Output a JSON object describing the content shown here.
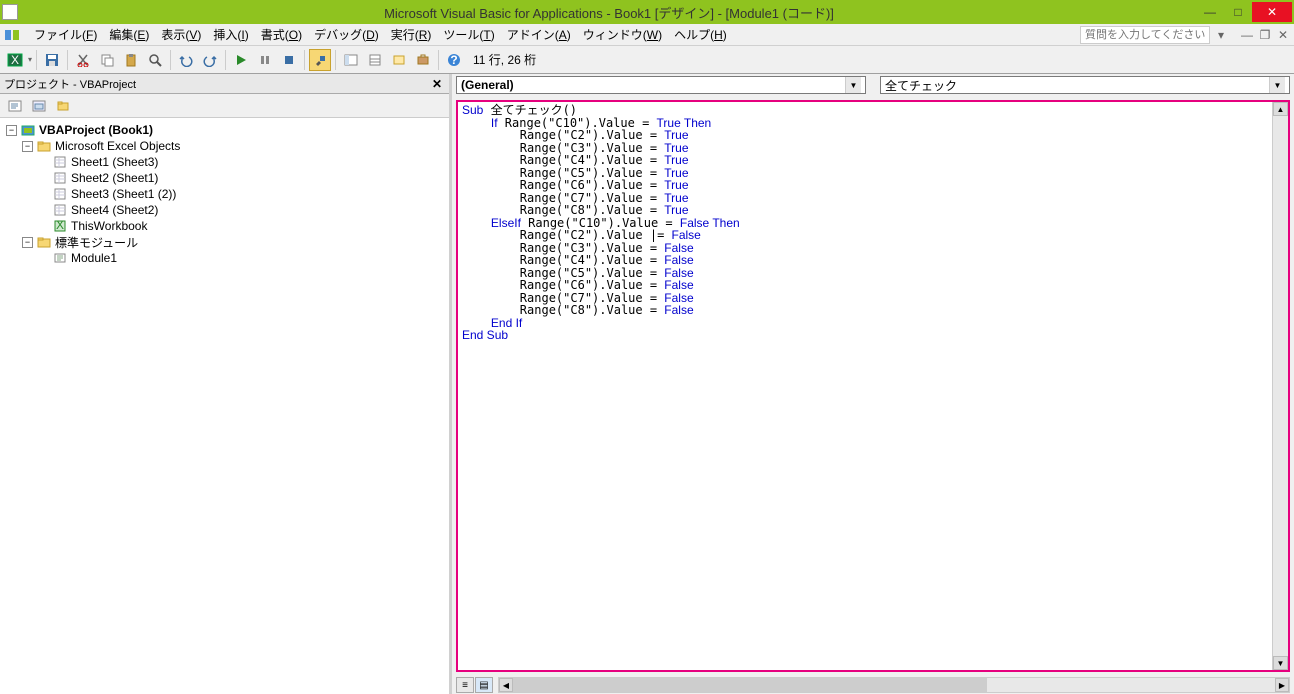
{
  "titlebar": {
    "title": "Microsoft Visual Basic for Applications - Book1 [デザイン] - [Module1 (コード)]"
  },
  "menubar": {
    "items": [
      {
        "label": "ファイル(F)",
        "key": "F"
      },
      {
        "label": "編集(E)",
        "key": "E"
      },
      {
        "label": "表示(V)",
        "key": "V"
      },
      {
        "label": "挿入(I)",
        "key": "I"
      },
      {
        "label": "書式(O)",
        "key": "O"
      },
      {
        "label": "デバッグ(D)",
        "key": "D"
      },
      {
        "label": "実行(R)",
        "key": "R"
      },
      {
        "label": "ツール(T)",
        "key": "T"
      },
      {
        "label": "アドイン(A)",
        "key": "A"
      },
      {
        "label": "ウィンドウ(W)",
        "key": "W"
      },
      {
        "label": "ヘルプ(H)",
        "key": "H"
      }
    ],
    "help_placeholder": "質問を入力してください"
  },
  "toolbar": {
    "status": "11 行, 26 桁"
  },
  "project_panel": {
    "header": "プロジェクト - VBAProject",
    "root": {
      "label": "VBAProject (Book1)"
    },
    "excel_objects": {
      "label": "Microsoft Excel Objects"
    },
    "sheets": [
      {
        "label": "Sheet1 (Sheet3)"
      },
      {
        "label": "Sheet2 (Sheet1)"
      },
      {
        "label": "Sheet3 (Sheet1 (2))"
      },
      {
        "label": "Sheet4 (Sheet2)"
      }
    ],
    "workbook": {
      "label": "ThisWorkbook"
    },
    "modules_folder": {
      "label": "標準モジュール"
    },
    "modules": [
      {
        "label": "Module1"
      }
    ]
  },
  "code_area": {
    "object_dd": "(General)",
    "proc_dd": "全てチェック",
    "code_lines": [
      {
        "indent": 0,
        "tokens": [
          {
            "t": "kw",
            "s": "Sub"
          },
          {
            "t": "p",
            "s": " 全てチェック()"
          }
        ]
      },
      {
        "indent": 1,
        "tokens": [
          {
            "t": "kw",
            "s": "If"
          },
          {
            "t": "p",
            "s": " Range(\"C10\").Value = "
          },
          {
            "t": "kw",
            "s": "True Then"
          }
        ]
      },
      {
        "indent": 2,
        "tokens": [
          {
            "t": "p",
            "s": "Range(\"C2\").Value = "
          },
          {
            "t": "kw",
            "s": "True"
          }
        ]
      },
      {
        "indent": 2,
        "tokens": [
          {
            "t": "p",
            "s": "Range(\"C3\").Value = "
          },
          {
            "t": "kw",
            "s": "True"
          }
        ]
      },
      {
        "indent": 2,
        "tokens": [
          {
            "t": "p",
            "s": "Range(\"C4\").Value = "
          },
          {
            "t": "kw",
            "s": "True"
          }
        ]
      },
      {
        "indent": 2,
        "tokens": [
          {
            "t": "p",
            "s": "Range(\"C5\").Value = "
          },
          {
            "t": "kw",
            "s": "True"
          }
        ]
      },
      {
        "indent": 2,
        "tokens": [
          {
            "t": "p",
            "s": "Range(\"C6\").Value = "
          },
          {
            "t": "kw",
            "s": "True"
          }
        ]
      },
      {
        "indent": 2,
        "tokens": [
          {
            "t": "p",
            "s": "Range(\"C7\").Value = "
          },
          {
            "t": "kw",
            "s": "True"
          }
        ]
      },
      {
        "indent": 2,
        "tokens": [
          {
            "t": "p",
            "s": "Range(\"C8\").Value = "
          },
          {
            "t": "kw",
            "s": "True"
          }
        ]
      },
      {
        "indent": 1,
        "tokens": [
          {
            "t": "kw",
            "s": "ElseIf"
          },
          {
            "t": "p",
            "s": " Range(\"C10\").Value = "
          },
          {
            "t": "kw",
            "s": "False Then"
          }
        ]
      },
      {
        "indent": 2,
        "tokens": [
          {
            "t": "p",
            "s": "Range(\"C2\").Value |= "
          },
          {
            "t": "kw",
            "s": "False"
          }
        ]
      },
      {
        "indent": 2,
        "tokens": [
          {
            "t": "p",
            "s": "Range(\"C3\").Value = "
          },
          {
            "t": "kw",
            "s": "False"
          }
        ]
      },
      {
        "indent": 2,
        "tokens": [
          {
            "t": "p",
            "s": "Range(\"C4\").Value = "
          },
          {
            "t": "kw",
            "s": "False"
          }
        ]
      },
      {
        "indent": 2,
        "tokens": [
          {
            "t": "p",
            "s": "Range(\"C5\").Value = "
          },
          {
            "t": "kw",
            "s": "False"
          }
        ]
      },
      {
        "indent": 2,
        "tokens": [
          {
            "t": "p",
            "s": "Range(\"C6\").Value = "
          },
          {
            "t": "kw",
            "s": "False"
          }
        ]
      },
      {
        "indent": 2,
        "tokens": [
          {
            "t": "p",
            "s": "Range(\"C7\").Value = "
          },
          {
            "t": "kw",
            "s": "False"
          }
        ]
      },
      {
        "indent": 2,
        "tokens": [
          {
            "t": "p",
            "s": "Range(\"C8\").Value = "
          },
          {
            "t": "kw",
            "s": "False"
          }
        ]
      },
      {
        "indent": 1,
        "tokens": [
          {
            "t": "kw",
            "s": "End If"
          }
        ]
      },
      {
        "indent": 0,
        "tokens": [
          {
            "t": "kw",
            "s": "End Sub"
          }
        ]
      }
    ]
  }
}
